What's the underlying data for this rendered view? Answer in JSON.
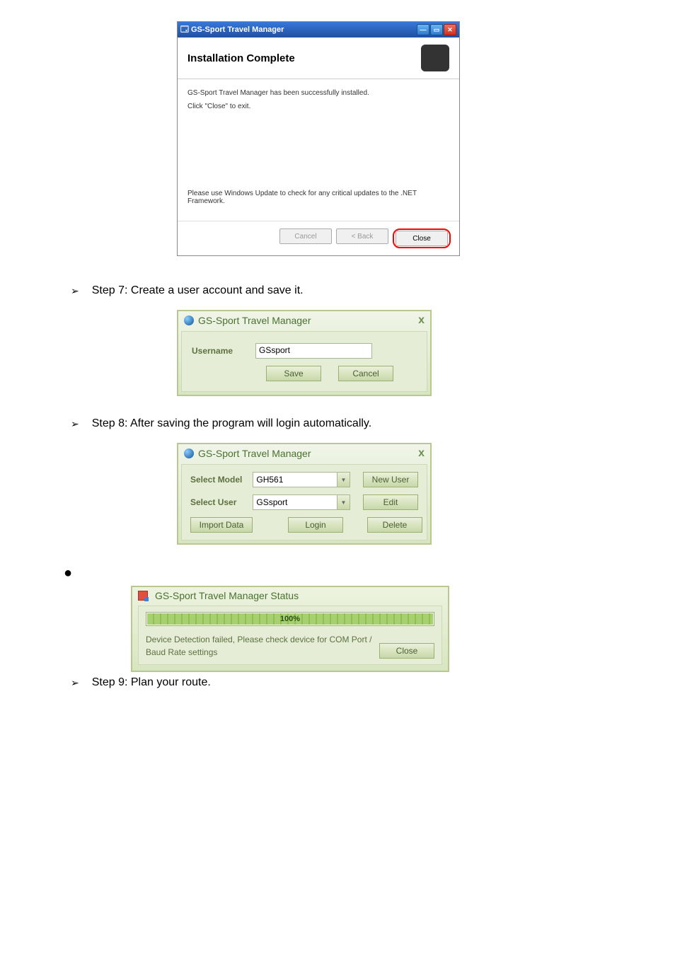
{
  "installer": {
    "title": "GS-Sport Travel Manager",
    "heading": "Installation Complete",
    "msg1": "GS-Sport Travel Manager has been successfully installed.",
    "msg2": "Click \"Close\" to exit.",
    "msg3": "Please use Windows Update to check for any critical updates to the .NET Framework.",
    "btn_cancel": "Cancel",
    "btn_back": "< Back",
    "btn_close": "Close"
  },
  "step7": {
    "text": "Step 7: Create a user account and save it."
  },
  "userDialog": {
    "title": "GS-Sport Travel Manager",
    "username_label": "Username",
    "username_value": "GSsport",
    "save": "Save",
    "cancel": "Cancel"
  },
  "step8": {
    "text": "Step 8: After saving the program will login automatically."
  },
  "loginDialog": {
    "title": "GS-Sport Travel Manager",
    "select_model_label": "Select Model",
    "select_model_value": "GH561",
    "select_user_label": "Select User",
    "select_user_value": "GSsport",
    "new_user": "New User",
    "edit": "Edit",
    "import_data": "Import Data",
    "login": "Login",
    "delete": "Delete"
  },
  "statusDialog": {
    "title": "GS-Sport Travel Manager Status",
    "progress": "100%",
    "message": "Device Detection failed, Please check device for COM Port / Baud Rate settings",
    "close": "Close"
  },
  "step9": {
    "text": "Step 9: Plan your route."
  }
}
